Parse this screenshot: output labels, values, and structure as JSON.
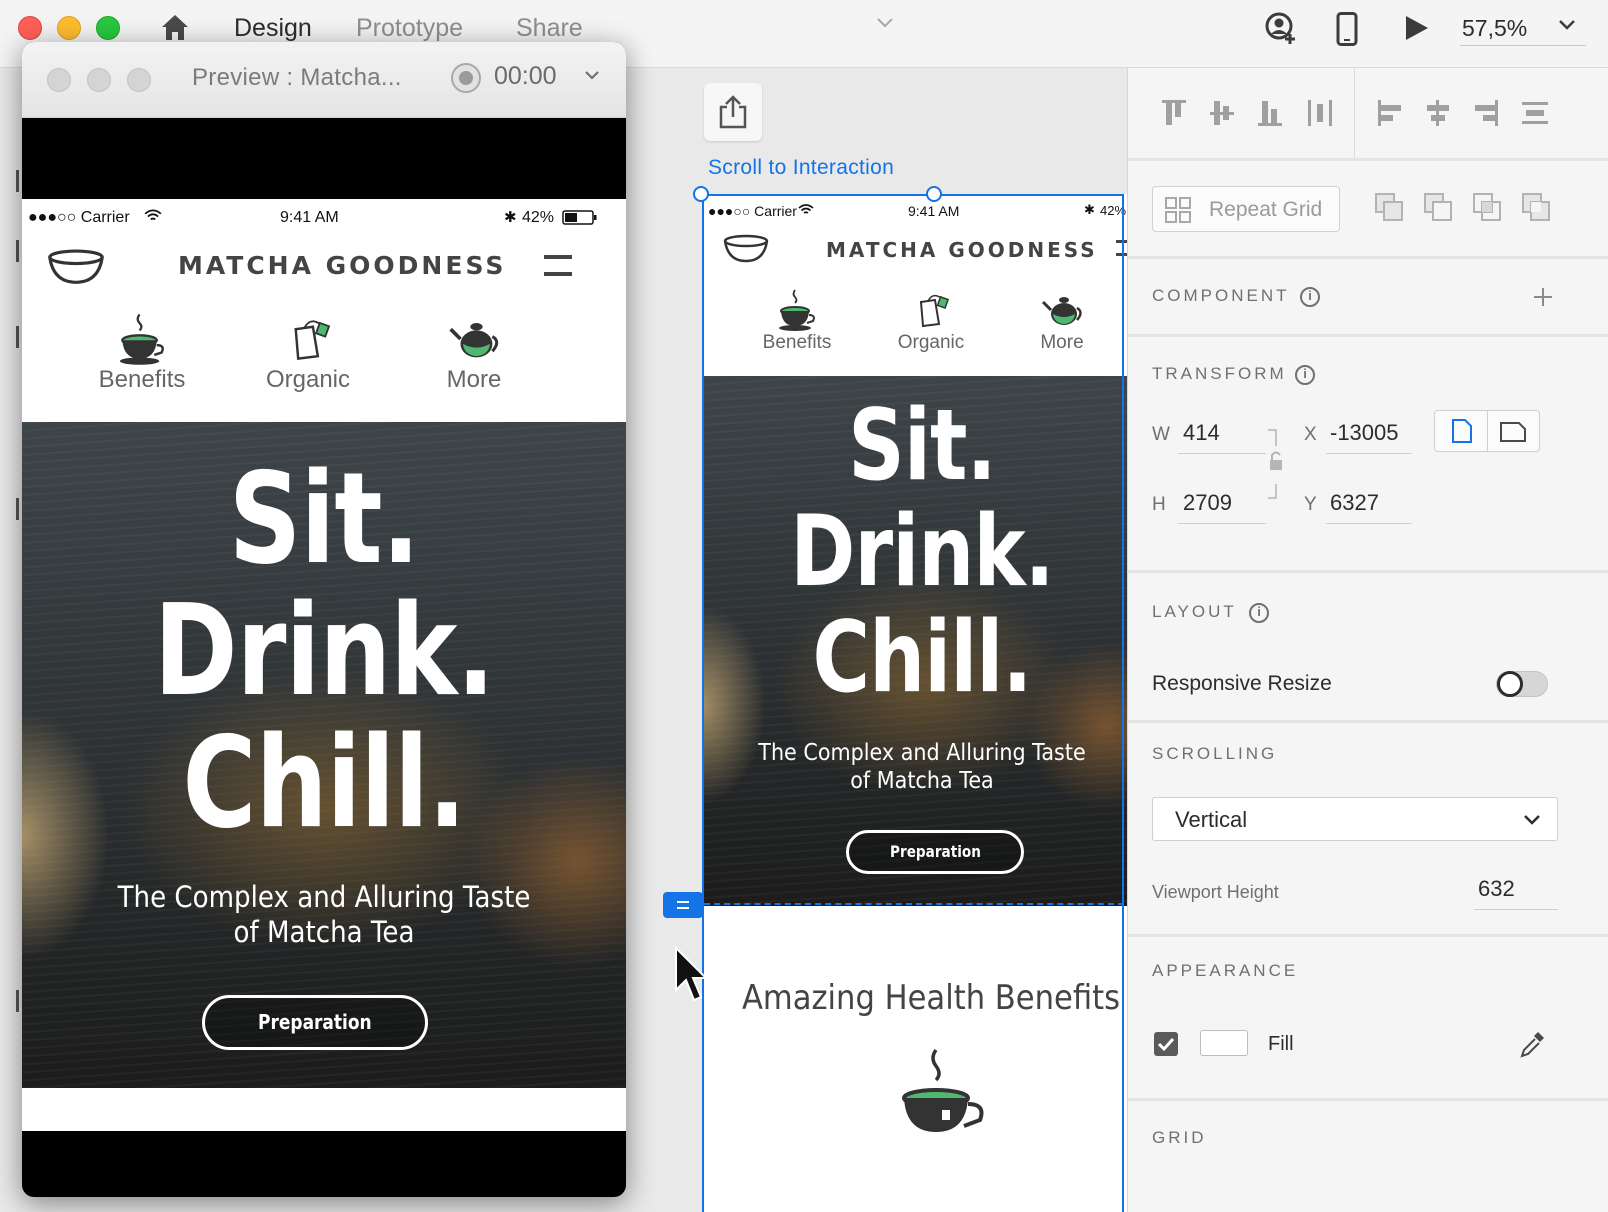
{
  "topbar": {
    "tabs": {
      "design": "Design",
      "prototype": "Prototype",
      "share": "Share"
    },
    "zoom": "57,5%",
    "icons": [
      "home-icon",
      "chevron-down-icon",
      "share-user-icon",
      "device-icon",
      "play-icon"
    ]
  },
  "preview": {
    "title": "Preview : Matcha...",
    "time": "00:00"
  },
  "phone": {
    "status": {
      "carrier": "●●●○○ Carrier",
      "time": "9:41 AM",
      "battery": "42%"
    },
    "brand": "MATCHA GOODNESS",
    "nav": [
      {
        "label": "Benefits",
        "icon": "teacup-icon"
      },
      {
        "label": "Organic",
        "icon": "teabag-icon"
      },
      {
        "label": "More",
        "icon": "teapot-icon"
      }
    ],
    "hero": {
      "line1": "Sit.",
      "line2": "Drink.",
      "line3": "Chill.",
      "tagline1": "The Complex and Alluring Taste",
      "tagline2": "of Matcha Tea",
      "button": "Preparation"
    }
  },
  "artboard": {
    "interaction_label": "Scroll to Interaction",
    "status": {
      "carrier": "●●●○○ Carrier",
      "time": "9:41 AM",
      "battery": "42%"
    },
    "section_title": "Amazing Health Benefits"
  },
  "panel": {
    "repeat_grid": "Repeat Grid",
    "component": {
      "title": "COMPONENT"
    },
    "transform": {
      "title": "TRANSFORM",
      "w_label": "W",
      "w": "414",
      "h_label": "H",
      "h": "2709",
      "x_label": "X",
      "x": "-13005",
      "y_label": "Y",
      "y": "6327"
    },
    "layout": {
      "title": "LAYOUT",
      "responsive_resize": "Responsive Resize",
      "responsive_resize_on": false
    },
    "scrolling": {
      "title": "SCROLLING",
      "value": "Vertical",
      "viewport_height_label": "Viewport Height",
      "viewport_height": "632"
    },
    "appearance": {
      "title": "APPEARANCE",
      "fill_label": "Fill",
      "fill_checked": true,
      "fill_color": "#ffffff"
    },
    "grid": {
      "title": "GRID"
    }
  },
  "colors": {
    "accent": "#1473e6",
    "matcha": "#4db86e",
    "hero_dark": "#2b2f31"
  }
}
